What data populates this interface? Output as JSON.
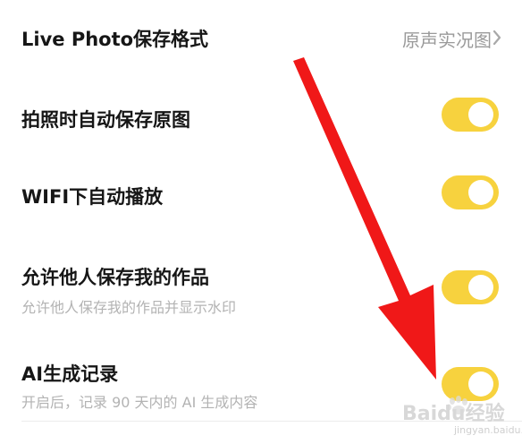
{
  "settings": {
    "live_photo": {
      "title": "Live Photo保存格式",
      "value": "原声实况图"
    },
    "auto_save_original": {
      "title": "拍照时自动保存原图",
      "enabled": true
    },
    "wifi_autoplay": {
      "title": "WIFI下自动播放",
      "enabled": true
    },
    "allow_save_works": {
      "title": "允许他人保存我的作品",
      "subtitle": "允许他人保存我的作品并显示水印",
      "enabled": true
    },
    "ai_record": {
      "title": "AI生成记录",
      "subtitle": "开启后，记录 90 天内的 AI 生成内容",
      "enabled": true
    }
  },
  "colors": {
    "toggle_on": "#f7d23e",
    "arrow": "#f01818"
  },
  "watermark": {
    "brand": "Baidu经验",
    "url": "jingyan.baidu.com"
  }
}
